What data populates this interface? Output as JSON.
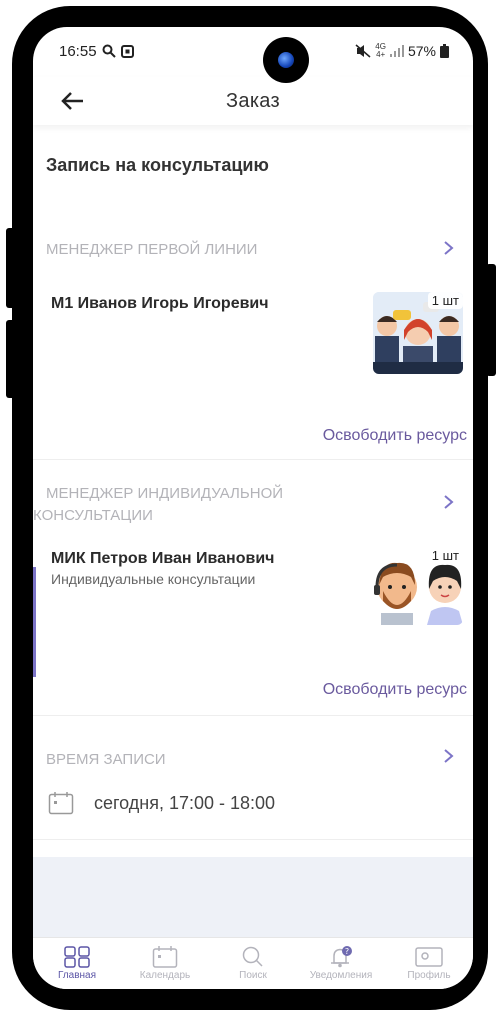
{
  "status": {
    "time": "16:55",
    "network": "4G",
    "network_sub": "4+",
    "battery": "57%"
  },
  "header": {
    "title": "Заказ"
  },
  "section_title": "Запись на консультацию",
  "resources": [
    {
      "label": "МЕНЕДЖЕР ПЕРВОЙ ЛИНИИ",
      "name": "М1 Иванов Игорь Игоревич",
      "subtitle": "",
      "qty": "1 шт",
      "release": "Освободить ресурс"
    },
    {
      "label_line1": "МЕНЕДЖЕР ИНДИВИДУАЛЬНОЙ",
      "label_line2": "КОНСУЛЬТАЦИИ",
      "name": "МИК Петров Иван Иванович",
      "subtitle": "Индивидуальные консультации",
      "qty": "1 шт",
      "release": "Освободить ресурс"
    }
  ],
  "booking_time": {
    "label": "ВРЕМЯ ЗАПИСИ",
    "value": "сегодня, 17:00 - 18:00"
  },
  "tabbar": {
    "items": [
      {
        "label": "Главная",
        "icon": "grid-icon",
        "active": true
      },
      {
        "label": "Календарь",
        "icon": "calendar-icon",
        "active": false
      },
      {
        "label": "Поиск",
        "icon": "search-icon",
        "active": false
      },
      {
        "label": "Уведомления",
        "icon": "bell-icon",
        "active": false
      },
      {
        "label": "Профиль",
        "icon": "profile-card-icon",
        "active": false
      }
    ]
  },
  "colors": {
    "accent": "#5b55a6",
    "link": "#6a5a9e",
    "muted_label": "#b3b3b8",
    "footer_bg": "#eef1f7"
  }
}
